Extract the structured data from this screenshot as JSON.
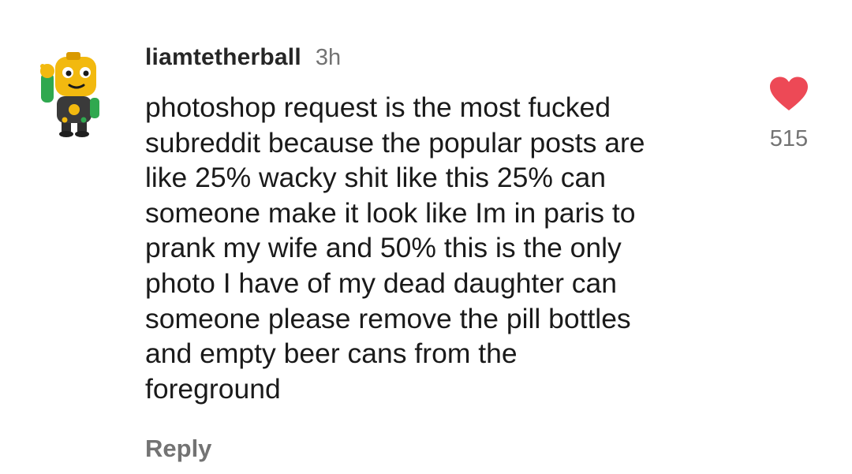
{
  "comment": {
    "username": "liamtetherball",
    "time": "3h",
    "text": "photoshop request is the most fucked\nsubreddit because the popular posts are\nlike 25% wacky shit like this 25% can\nsomeone make it look like Im in paris to\nprank my wife and 50% this is the only\nphoto I have of my dead daughter can\nsomeone please remove the pill bottles\nand empty beer cans from the\nforeground",
    "reply_label": "Reply",
    "like_count": "515",
    "liked": true
  },
  "icons": {
    "avatar": "robot-character-avatar",
    "like": "heart-filled-icon"
  },
  "colors": {
    "heart": "#ed4956",
    "secondary_text": "#737373",
    "avatar_yellow": "#f2b90f"
  }
}
